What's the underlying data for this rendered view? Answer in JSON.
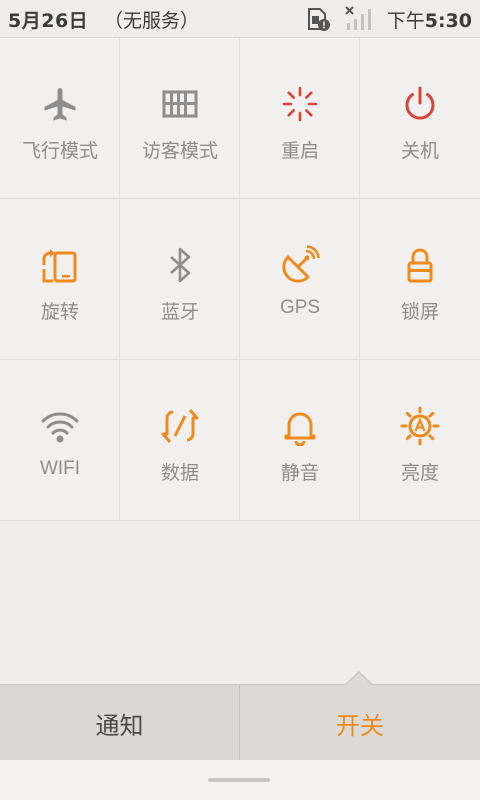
{
  "status_bar": {
    "date": "5月26日",
    "carrier": "（无服务）",
    "time_prefix": "下午",
    "time": "5:30",
    "icons": [
      "sim-alert-icon",
      "no-signal-icon"
    ]
  },
  "colors": {
    "accent": "#f08a1c",
    "inactive": "#8e8e8e",
    "restart": "#d9443a",
    "background": "#f2f0ee"
  },
  "tiles": [
    {
      "label": "飞行模式",
      "icon": "airplane-icon",
      "state": "off"
    },
    {
      "label": "访客模式",
      "icon": "guest-mode-icon",
      "state": "off"
    },
    {
      "label": "重启",
      "icon": "restart-icon",
      "state": "action"
    },
    {
      "label": "关机",
      "icon": "power-icon",
      "state": "action"
    },
    {
      "label": "旋转",
      "icon": "rotate-icon",
      "state": "on"
    },
    {
      "label": "蓝牙",
      "icon": "bluetooth-icon",
      "state": "off"
    },
    {
      "label": "GPS",
      "icon": "gps-icon",
      "state": "on"
    },
    {
      "label": "锁屏",
      "icon": "lock-icon",
      "state": "on"
    },
    {
      "label": "WIFI",
      "icon": "wifi-icon",
      "state": "off"
    },
    {
      "label": "数据",
      "icon": "data-icon",
      "state": "on"
    },
    {
      "label": "静音",
      "icon": "bell-icon",
      "state": "on"
    },
    {
      "label": "亮度",
      "icon": "brightness-icon",
      "state": "on"
    }
  ],
  "tabs": {
    "notifications": "通知",
    "toggles": "开关",
    "active": "toggles"
  }
}
